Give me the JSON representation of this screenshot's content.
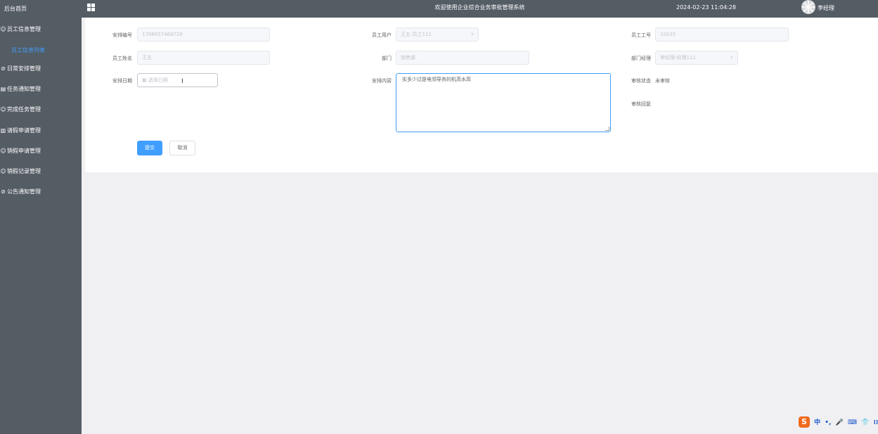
{
  "sidebar": {
    "home": "后台首页",
    "items": [
      {
        "icon": "☺",
        "label": "员工信息管理"
      },
      {
        "icon": "⊘",
        "label": "日常安排管理"
      },
      {
        "icon": "▤",
        "label": "任务通知管理"
      },
      {
        "icon": "☺",
        "label": "完成任务管理"
      },
      {
        "icon": "▥",
        "label": "请假申请管理"
      },
      {
        "icon": "☺",
        "label": "销假申请管理"
      },
      {
        "icon": "☺",
        "label": "销假记录管理"
      },
      {
        "icon": "⊘",
        "label": "公告通知管理"
      }
    ],
    "sub_active": "员工信息列表",
    "active_color": "#409eff"
  },
  "topbar": {
    "title": "欢迎使用企业综合业务审批管理系统",
    "datetime": "2024-02-23 11:04:28",
    "user": "李经理"
  },
  "form": {
    "schedule_no": {
      "label": "安排编号",
      "value": "1708657468728"
    },
    "employee_user": {
      "label": "员工用户",
      "value": "王五-员工111"
    },
    "employee_no": {
      "label": "员工工号",
      "value": "10025"
    },
    "employee_name": {
      "label": "员工姓名",
      "value": "王五"
    },
    "department": {
      "label": "部门",
      "value": "销售部"
    },
    "dept_manager": {
      "label": "部门经理",
      "value": "李经理-经理111"
    },
    "schedule_date": {
      "label": "安排日期",
      "placeholder": "选择日期"
    },
    "schedule_content": {
      "label": "安排内容",
      "value": "实多少过是电领导务的机高水高"
    },
    "review_status": {
      "label": "审核状态",
      "value": "未审核"
    },
    "review_reply": {
      "label": "审核回复",
      "value": ""
    },
    "submit_label": "提交",
    "cancel_label": "取消"
  },
  "ime": {
    "logo": "S",
    "items": [
      "中",
      "•,",
      "🎤",
      "⌨",
      "👕",
      "⁞⁞"
    ]
  }
}
